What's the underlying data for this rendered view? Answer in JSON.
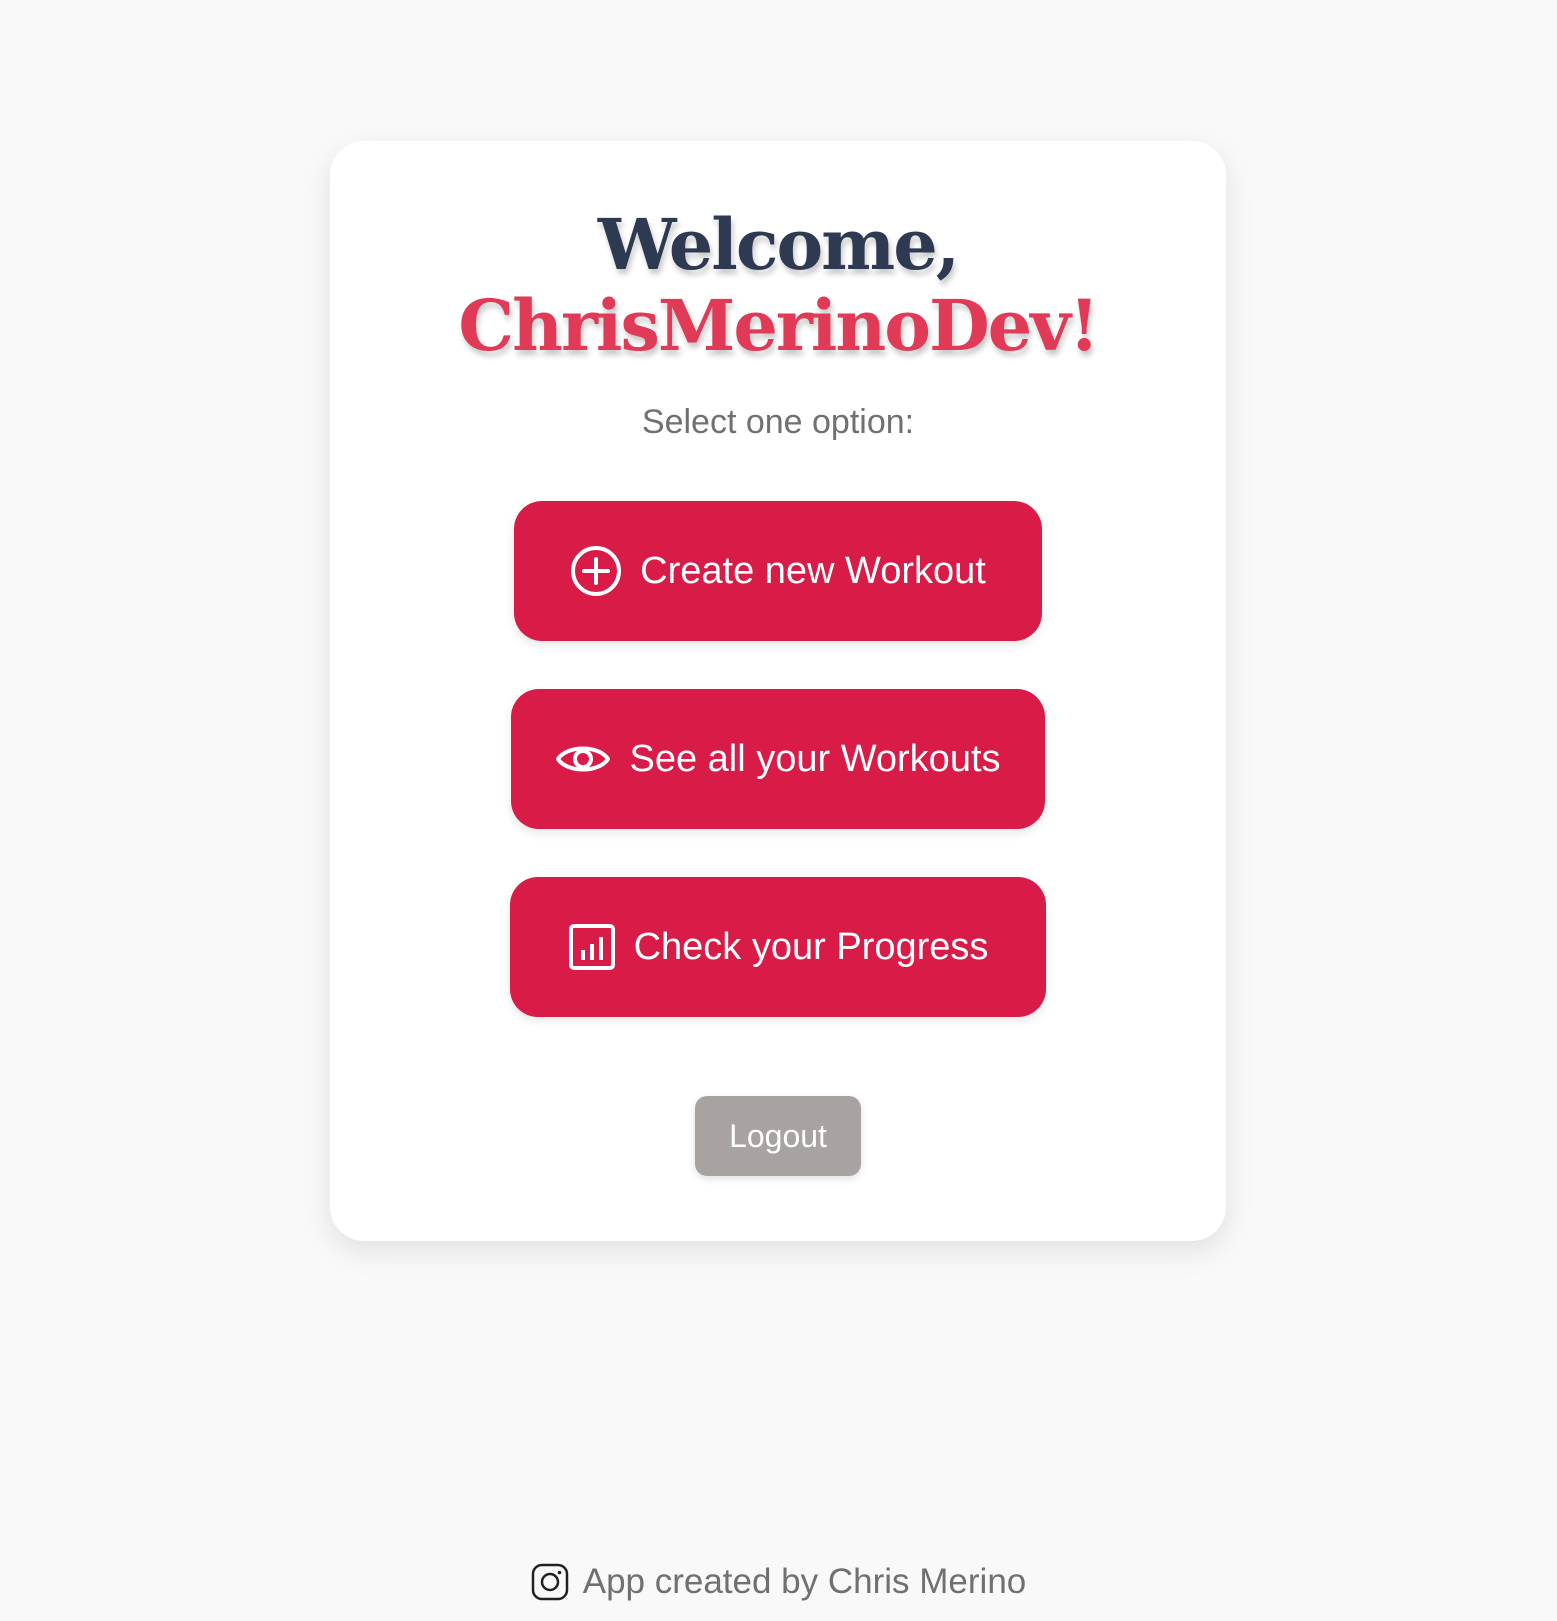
{
  "card": {
    "welcome_line1": "Welcome,",
    "welcome_line2": "ChrisMerinoDev!",
    "subtitle": "Select one option:",
    "actions": [
      {
        "label": "Create new Workout",
        "icon": "plus-circle-icon"
      },
      {
        "label": "See all your Workouts",
        "icon": "eye-icon"
      },
      {
        "label": "Check your Progress",
        "icon": "bar-chart-icon"
      }
    ],
    "logout_label": "Logout"
  },
  "footer": {
    "text": "App created by Chris Merino",
    "icon": "instagram-icon"
  },
  "colors": {
    "background": "#f9f9f9",
    "card": "#ffffff",
    "heading_dark": "#2e3a52",
    "heading_accent": "#e03a57",
    "button_primary": "#d81b47",
    "button_logout": "#a8a3a0",
    "muted_text": "#707070"
  }
}
